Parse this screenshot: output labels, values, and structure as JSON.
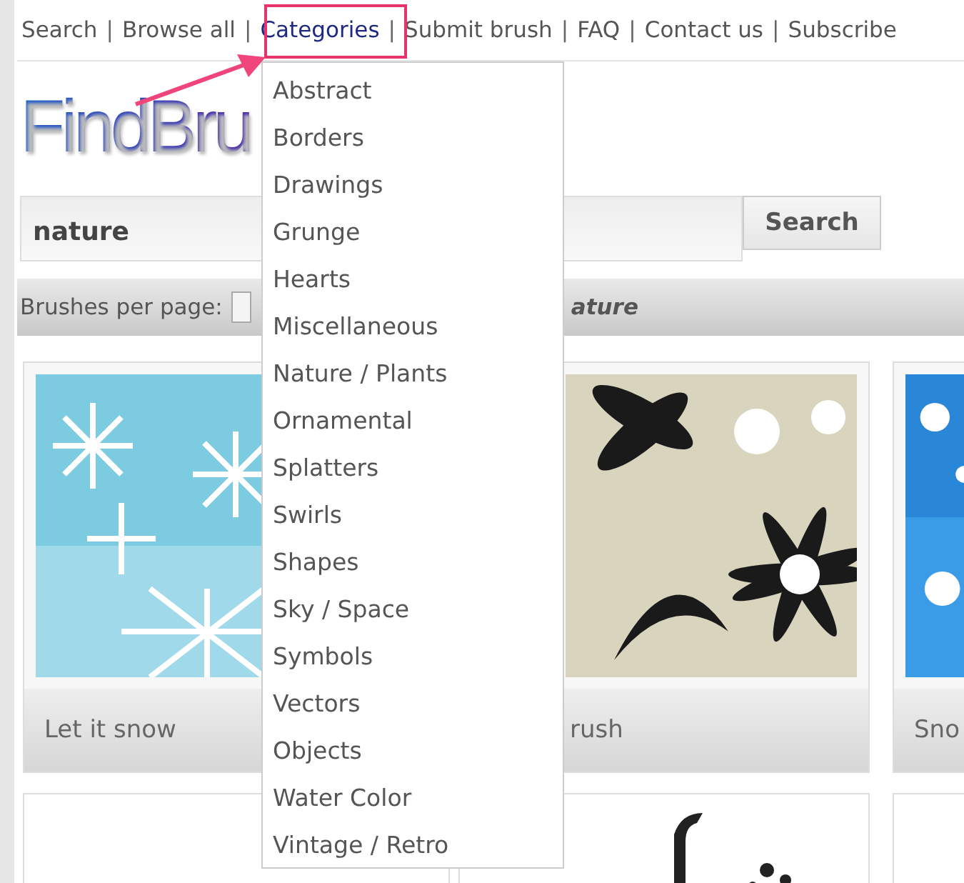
{
  "nav": {
    "separator": "|",
    "links": [
      {
        "label": "Search",
        "selected": false
      },
      {
        "label": "Browse all",
        "selected": false
      },
      {
        "label": "Categories",
        "selected": true
      },
      {
        "label": "Submit brush",
        "selected": false
      },
      {
        "label": "FAQ",
        "selected": false
      },
      {
        "label": "Contact us",
        "selected": false
      },
      {
        "label": "Subscribe",
        "selected": false
      }
    ]
  },
  "logo": "FindBru",
  "search": {
    "value": "nature",
    "button": "Search"
  },
  "toolbar": {
    "label": "Brushes per page:",
    "query": "ature"
  },
  "cards": [
    {
      "caption": "Let it snow"
    },
    {
      "caption": "rush"
    },
    {
      "caption": "Sno"
    }
  ],
  "second_row": [
    {
      "kind": "empty"
    },
    {
      "kind": "picture"
    },
    {
      "kind": "empty"
    }
  ],
  "categories_menu": {
    "items": [
      "Abstract",
      "Borders",
      "Drawings",
      "Grunge",
      "Hearts",
      "Miscellaneous",
      "Nature / Plants",
      "Ornamental",
      "Splatters",
      "Swirls",
      "Shapes",
      "Sky / Space",
      "Symbols",
      "Vectors",
      "Objects",
      "Water Color",
      "Vintage / Retro"
    ]
  }
}
